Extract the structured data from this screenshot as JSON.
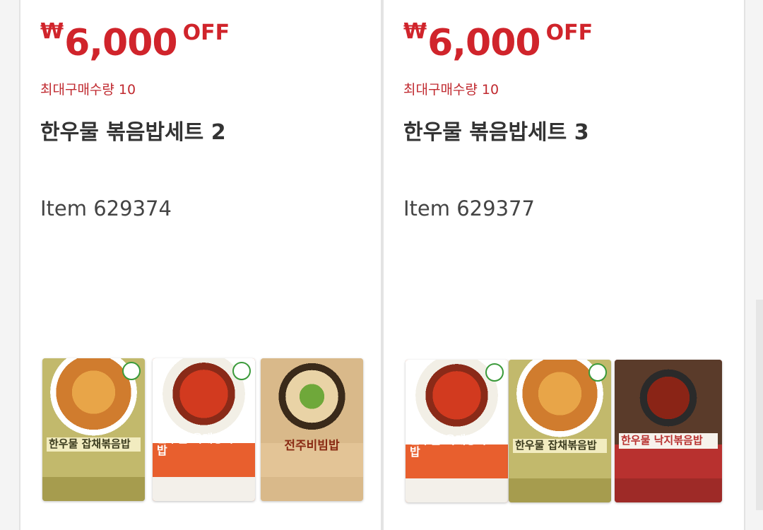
{
  "products": [
    {
      "currency": "₩",
      "discount": "6,000",
      "off": "OFF",
      "max_qty": "최대구매수량 10",
      "title": "한우물 볶음밥세트 2",
      "item": "Item 629374",
      "packages": [
        {
          "name": "한우물 잡채볶음밥",
          "icon": "japchae-fried-rice-package"
        },
        {
          "name": "한우물 육개장국밥",
          "icon": "yukgaejang-gukbap-package"
        },
        {
          "name": "전주비빔밥",
          "icon": "jeonju-bibimbap-package"
        }
      ]
    },
    {
      "currency": "₩",
      "discount": "6,000",
      "off": "OFF",
      "max_qty": "최대구매수량 10",
      "title": "한우물 볶음밥세트 3",
      "item": "Item 629377",
      "packages": [
        {
          "name": "한우물 육개장국밥",
          "icon": "yukgaejang-gukbap-package"
        },
        {
          "name": "한우물 잡채볶음밥",
          "icon": "japchae-fried-rice-package"
        },
        {
          "name": "한우물 낙지볶음밥",
          "icon": "nakji-fried-rice-package"
        }
      ]
    }
  ],
  "colors": {
    "price_red": "#d0242b",
    "japchae_green": "#b8ad5a",
    "yukgaejang_orange": "#e45a2a",
    "bibimbap_tan": "#d9b98a",
    "nakji_red": "#b8312f"
  }
}
